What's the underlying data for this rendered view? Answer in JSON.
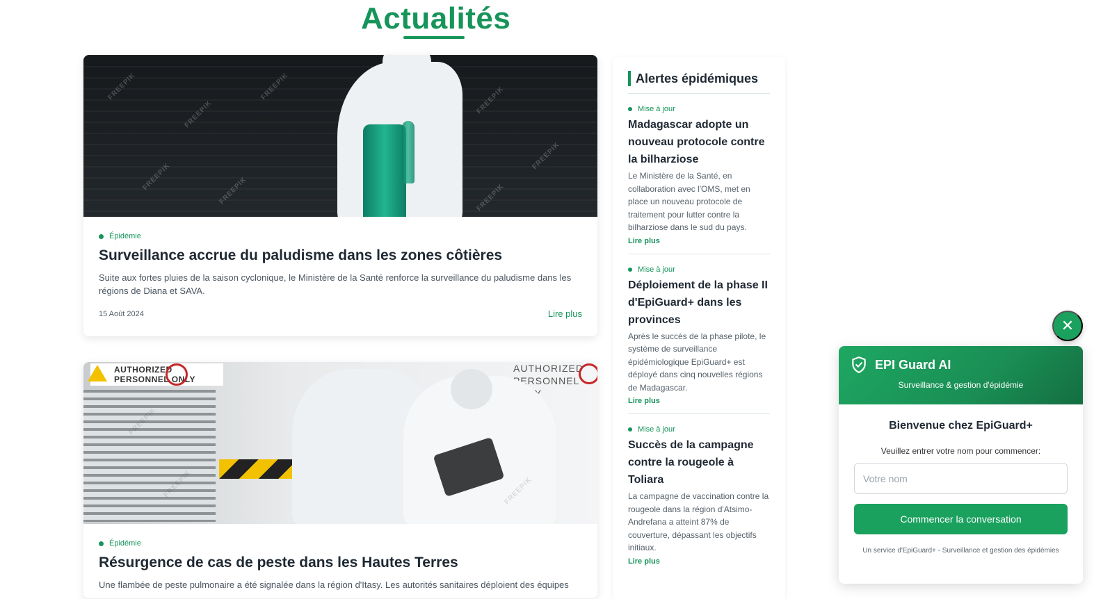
{
  "section": {
    "title": "Actualités"
  },
  "news": [
    {
      "category": "Épidémie",
      "title": "Surveillance accrue du paludisme dans les zones côtières",
      "summary": "Suite aux fortes pluies de la saison cyclonique, le Ministère de la Santé renforce la surveillance du paludisme dans les régions de Diana et SAVA.",
      "date": "15 Août 2024",
      "more": "Lire plus",
      "watermark": "FREEPIK"
    },
    {
      "category": "Épidémie",
      "title": "Résurgence de cas de peste dans les Hautes Terres",
      "summary": "Une flambée de peste pulmonaire a été signalée dans la région d'Itasy. Les autorités sanitaires déploient des équipes",
      "sign_left": [
        "AUTHORIZED",
        "PERSONNEL ONLY"
      ],
      "sign_right": [
        "AUTHORIZED",
        "PERSONNEL ONLY"
      ],
      "watermark": "FREEPIK"
    }
  ],
  "sidebar": {
    "title": "Alertes épidémiques",
    "alerts": [
      {
        "tag": "Mise à jour",
        "title": "Madagascar adopte un nouveau protocole contre la bilharziose",
        "text": "Le Ministère de la Santé, en collaboration avec l'OMS, met en place un nouveau protocole de traitement pour lutter contre la bilharziose dans le sud du pays.",
        "more": "Lire plus"
      },
      {
        "tag": "Mise à jour",
        "title": "Déploiement de la phase II d'EpiGuard+ dans les provinces",
        "text": "Après le succès de la phase pilote, le système de surveillance épidémiologique EpiGuard+ est déployé dans cinq nouvelles régions de Madagascar.",
        "more": "Lire plus"
      },
      {
        "tag": "Mise à jour",
        "title": "Succès de la campagne contre la rougeole à Toliara",
        "text": "La campagne de vaccination contre la rougeole dans la région d'Atsimo-Andrefana a atteint 87% de couverture, dépassant les objectifs initiaux.",
        "more": "Lire plus"
      }
    ]
  },
  "chat": {
    "close_symbol": "✕",
    "brand": "EPI Guard AI",
    "subtitle": "Surveillance & gestion d'épidémie",
    "welcome": "Bienvenue chez EpiGuard+",
    "prompt": "Veuillez entrer votre nom pour commencer:",
    "placeholder": "Votre nom",
    "button": "Commencer la conversation",
    "footer": "Un service d'EpiGuard+ - Surveillance et gestion des épidémies"
  },
  "colors": {
    "accent": "#16945a",
    "button": "#1aa15e"
  }
}
